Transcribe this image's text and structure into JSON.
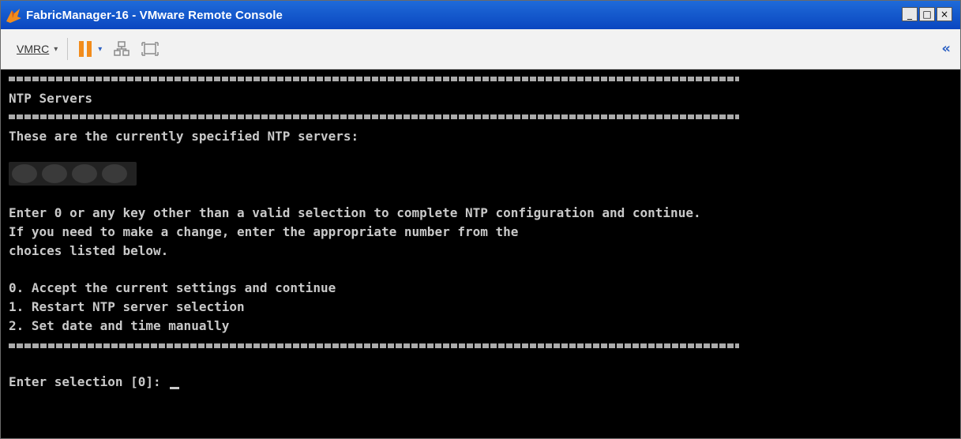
{
  "window": {
    "title": "FabricManager-16 - VMware Remote Console"
  },
  "window_controls": {
    "minimize": "_",
    "maximize": "□",
    "close": "×"
  },
  "toolbar": {
    "vmrc_label": "VMRC",
    "vmrc_caret": "▾",
    "power_caret": "▾",
    "collapse": "«"
  },
  "console": {
    "rule": "==========================================================================",
    "heading": "NTP Servers",
    "current_label": "These are the currently specified NTP servers:",
    "instructions": [
      "Enter 0 or any key other than a valid selection to complete NTP configuration and continue.",
      "If you need to make a change, enter the appropriate number from the",
      "choices listed below."
    ],
    "options": [
      "0. Accept the current settings and continue",
      "1. Restart NTP server selection",
      "2. Set date and time manually"
    ],
    "prompt": "Enter selection [0]: "
  },
  "colors": {
    "titlebar": "#0a46c0",
    "console_bg": "#000000",
    "console_fg": "#c9c9c9",
    "pause": "#f28c1c"
  }
}
